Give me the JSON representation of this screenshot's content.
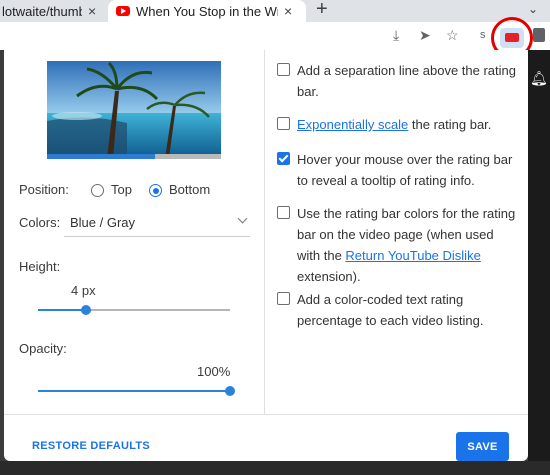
{
  "tabs": [
    {
      "title": "lotwaite/thumb",
      "close": "×"
    },
    {
      "title": "When You Stop in the Wro",
      "close": "×"
    }
  ],
  "new_tab": "+",
  "tab_menu": "⌄",
  "toolbar": {
    "profile_initial": "s"
  },
  "popup": {
    "position_label": "Position:",
    "position_options": [
      "Top",
      "Bottom"
    ],
    "position_selected": "Bottom",
    "colors_label": "Colors:",
    "colors_value": "Blue / Gray",
    "height_label": "Height:",
    "height_value": "4 px",
    "height_fraction": 0.25,
    "opacity_label": "Opacity:",
    "opacity_value": "100%",
    "opacity_fraction": 1.0,
    "rating_bar_fraction": 0.62,
    "options": [
      {
        "checked": false,
        "text": "Add a separation line above the rating bar."
      },
      {
        "checked": false,
        "link": "Exponentially scale",
        "text_after": " the rating bar."
      },
      {
        "checked": true,
        "text": "Hover your mouse over the rating bar to reveal a tooltip of rating info."
      },
      {
        "checked": false,
        "text_before": "Use the rating bar colors for the rating bar on the video page (when used with the ",
        "link": "Return YouTube Dislike",
        "text_after": " extension)."
      },
      {
        "checked": false,
        "text": "Add a color-coded text rating percentage to each video listing."
      }
    ],
    "restore_label": "RESTORE DEFAULTS",
    "save_label": "SAVE"
  },
  "colors": {
    "accent": "#1a73e8",
    "rating_blue": "#2e7bd6",
    "rating_gray": "#b9b9b9",
    "highlight_circle": "#e00000"
  }
}
